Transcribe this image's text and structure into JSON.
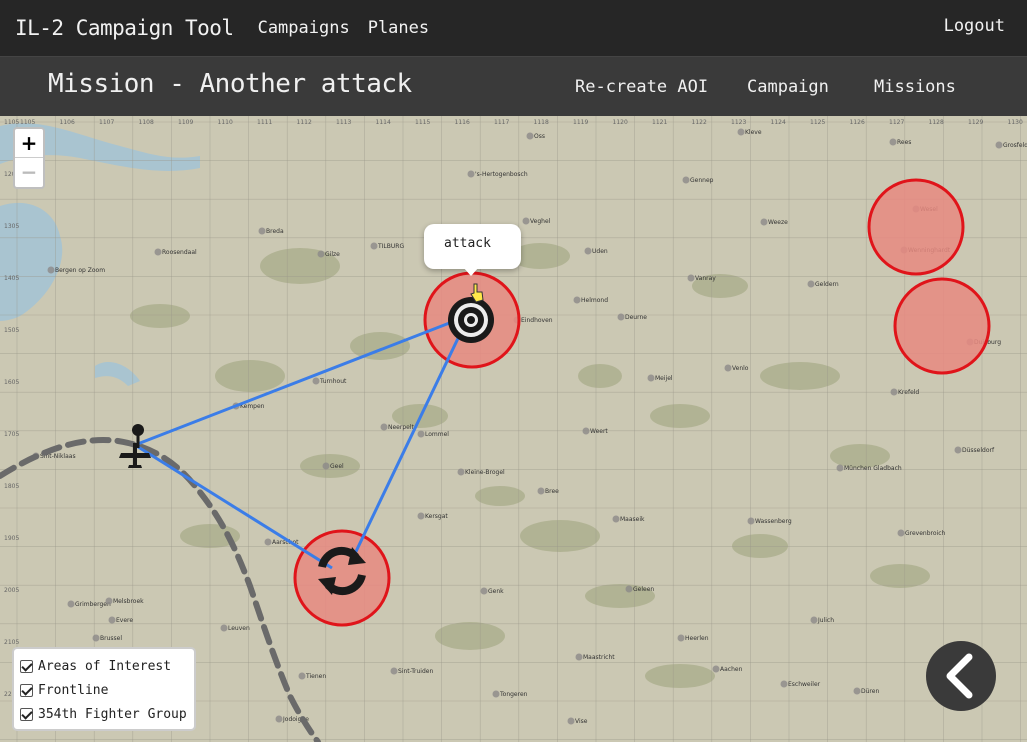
{
  "app": {
    "brand": "IL-2 Campaign Tool",
    "nav": [
      "Campaigns",
      "Planes"
    ],
    "logout": "Logout"
  },
  "subheader": {
    "title": "Mission - Another attack",
    "links": [
      "Re-create AOI",
      "Campaign",
      "Missions"
    ]
  },
  "map": {
    "zoom_in": "+",
    "zoom_out": "−",
    "popup_text": "attack",
    "place_labels": [
      "Oss",
      "Kleve",
      "Rees",
      "Grosfeld",
      "'s-Hertogenbosch",
      "Gennep",
      "Wesel",
      "Breda",
      "Gilze",
      "TILBURG",
      "Veghel",
      "Uden",
      "Weeze",
      "Roosendaal",
      "Bergen op Zoom",
      "Helmond",
      "Deurne",
      "Vanray",
      "Geldern",
      "Eindhoven",
      "Venlo",
      "Meijel",
      "Turnhout",
      "Kempen",
      "Krefeld",
      "Weert",
      "Lommel",
      "Neerpelt",
      "Geel",
      "Kleine-Brogel",
      "Bree",
      "Sint-Niklaas",
      "München Gladbach",
      "Düsseldorf",
      "Wassenberg",
      "Kersgat",
      "Maaseik",
      "Aarschot",
      "Genk",
      "Geleen",
      "Grevenbroich",
      "Grimbergen",
      "Melsbroek",
      "Leuven",
      "Evere",
      "Brussel",
      "Heerlen",
      "Julich",
      "Maastricht",
      "Tienen",
      "Sint-Truiden",
      "Tongeren",
      "Aachen",
      "Eschweiler",
      "Düren",
      "Jodoigne",
      "Vise",
      "Duisburg",
      "Wenninghardt"
    ],
    "colors": {
      "aoi_fill": "#e88a80",
      "aoi_stroke": "#e0141a",
      "route": "#3b7de8",
      "frontline": "#6a6a6a",
      "land": "#cbc8b3",
      "water": "#a9c4d0",
      "forest": "#9da37a"
    },
    "icons": {
      "target": "target-icon",
      "refresh": "refresh-icon",
      "plane": "plane-icon",
      "airfield_pin": "pin-icon"
    },
    "grid_labels_left": [
      "1105",
      "1205",
      "1305",
      "1405",
      "1505",
      "1605",
      "1705",
      "1805",
      "1905",
      "2005",
      "2105",
      "2205"
    ],
    "grid_labels_top": [
      "1105",
      "1106",
      "1107",
      "1108",
      "1109",
      "1110",
      "1111",
      "1112",
      "1113",
      "1114",
      "1115",
      "1116",
      "1117",
      "1118",
      "1119",
      "1120",
      "1121",
      "1122",
      "1123",
      "1124",
      "1125",
      "1126",
      "1127",
      "1128",
      "1129",
      "1130"
    ]
  },
  "layers": [
    {
      "label": "Areas of Interest",
      "checked": true
    },
    {
      "label": "Frontline",
      "checked": true
    },
    {
      "label": "354th Fighter Group",
      "checked": true
    }
  ],
  "back_button": {
    "icon": "chevron-left-icon"
  }
}
